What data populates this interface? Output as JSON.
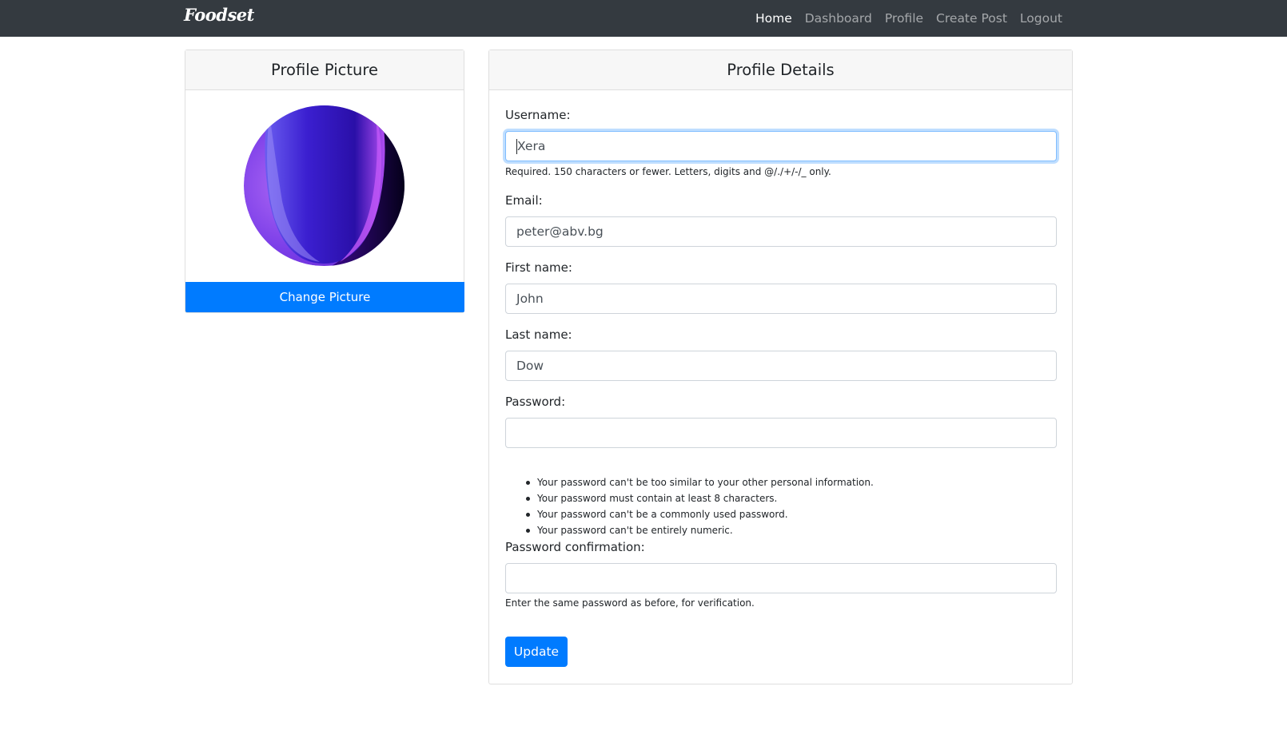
{
  "navbar": {
    "brand": "Foodset",
    "links": [
      "Home",
      "Dashboard",
      "Profile",
      "Create Post",
      "Logout"
    ],
    "active": "Home"
  },
  "profile_picture": {
    "title": "Profile Picture",
    "change_label": "Change Picture"
  },
  "profile_details": {
    "title": "Profile Details",
    "username": {
      "label": "Username:",
      "value": "Xera",
      "help": "Required. 150 characters or fewer. Letters, digits and @/./+/-/_ only."
    },
    "email": {
      "label": "Email:",
      "value": "peter@abv.bg"
    },
    "first_name": {
      "label": "First name:",
      "value": "John"
    },
    "last_name": {
      "label": "Last name:",
      "value": "Dow"
    },
    "password": {
      "label": "Password:",
      "value": "",
      "rules": [
        "Your password can't be too similar to your other personal information.",
        "Your password must contain at least 8 characters.",
        "Your password can't be a commonly used password.",
        "Your password can't be entirely numeric."
      ]
    },
    "password_confirmation": {
      "label": "Password confirmation:",
      "value": "",
      "help": "Enter the same password as before, for verification."
    },
    "update_label": "Update"
  },
  "colors": {
    "navbar_bg": "#343a40",
    "primary": "#007bff",
    "avatar_gradient": [
      "#a855f7",
      "#4f1fd1",
      "#1a0066"
    ]
  }
}
